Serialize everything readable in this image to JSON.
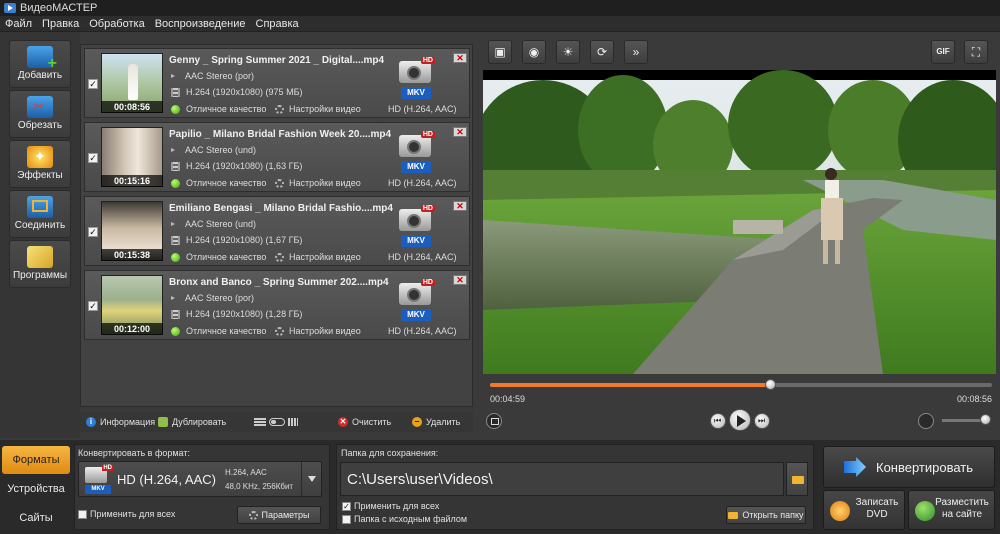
{
  "window": {
    "title": "ВидеоМАСТЕР"
  },
  "menu": [
    "Файл",
    "Правка",
    "Обработка",
    "Воспроизведение",
    "Справка"
  ],
  "tools": [
    {
      "label": "Добавить",
      "icon": "add-film-icon"
    },
    {
      "label": "Обрезать",
      "icon": "scissors-film-icon"
    },
    {
      "label": "Эффекты",
      "icon": "effects-wand-icon"
    },
    {
      "label": "Соединить",
      "icon": "join-film-icon"
    },
    {
      "label": "Программы",
      "icon": "programs-icon"
    }
  ],
  "files": [
    {
      "name": "Genny _ Spring Summer 2021 _ Digital....mp4",
      "duration": "00:08:56",
      "audio": "AAC Stereo (por)",
      "video": "H.264 (1920x1080) (975 МБ)",
      "quality": "Отличное качество",
      "settings": "Настройки видео",
      "badge": "HD",
      "container": "MKV",
      "format": "HD (H.264, AAC)",
      "checked": "✓"
    },
    {
      "name": "Papilio _ Milano Bridal Fashion Week 20....mp4",
      "duration": "00:15:16",
      "audio": "AAC Stereo (und)",
      "video": "H.264 (1920x1080) (1,63 ГБ)",
      "quality": "Отличное качество",
      "settings": "Настройки видео",
      "badge": "HD",
      "container": "MKV",
      "format": "HD (H.264, AAC)",
      "checked": "✓"
    },
    {
      "name": "Emiliano Bengasi _ Milano Bridal Fashio....mp4",
      "duration": "00:15:38",
      "audio": "AAC Stereo (und)",
      "video": "H.264 (1920x1080) (1,67 ГБ)",
      "quality": "Отличное качество",
      "settings": "Настройки видео",
      "badge": "HD",
      "container": "MKV",
      "format": "HD (H.264, AAC)",
      "checked": "✓"
    },
    {
      "name": "Bronx and Banco _ Spring Summer 202....mp4",
      "duration": "00:12:00",
      "audio": "AAC Stereo (por)",
      "video": "H.264 (1920x1080) (1,28 ГБ)",
      "quality": "Отличное качество",
      "settings": "Настройки видео",
      "badge": "HD",
      "container": "MKV",
      "format": "HD (H.264, AAC)",
      "checked": "✓"
    }
  ],
  "list_toolbar": {
    "info": "Информация",
    "duplicate": "Дублировать",
    "clear": "Очистить",
    "delete": "Удалить"
  },
  "preview": {
    "current_time": "00:04:59",
    "total_time": "00:08:56",
    "progress": 0.557,
    "volume": 0.9,
    "gif_label": "GIF"
  },
  "side_tabs": [
    "Форматы",
    "Устройства",
    "Сайты"
  ],
  "format_panel": {
    "label": "Конвертировать в формат:",
    "name": "HD (H.264, AAC)",
    "spec_1": "H.264, AAC",
    "spec_2": "48,0 KHz, 256Кбит",
    "badge": "HD",
    "container": "MKV",
    "apply_all": "Применить для всех",
    "params": "Параметры"
  },
  "folder_panel": {
    "label": "Папка для сохранения:",
    "path": "C:\\Users\\user\\Videos\\",
    "apply_all": "Применить для всех",
    "source_folder": "Папка с исходным файлом",
    "open_folder": "Открыть папку"
  },
  "actions": {
    "convert": "Конвертировать",
    "burn_dvd": "Записать DVD",
    "publish": "Разместить на сайте"
  },
  "colors": {
    "accent": "#f07a2a",
    "active_tab": "#f5b642",
    "mkv_blue": "#1a5fc0",
    "hd_red": "#c32121"
  }
}
